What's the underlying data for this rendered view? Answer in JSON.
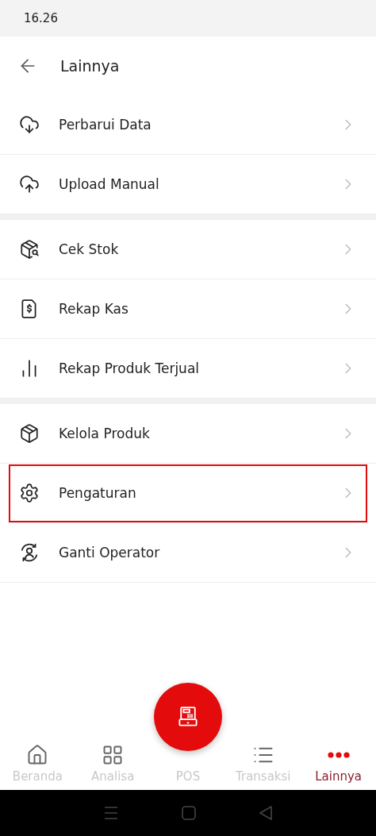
{
  "status_bar": {
    "time": "16.26"
  },
  "header": {
    "title": "Lainnya"
  },
  "groups": [
    {
      "items": [
        {
          "kind": "download",
          "label": "Perbarui Data",
          "highlighted": false
        },
        {
          "kind": "upload",
          "label": "Upload Manual",
          "highlighted": false
        }
      ]
    },
    {
      "items": [
        {
          "kind": "stock",
          "label": "Cek Stok",
          "highlighted": false
        },
        {
          "kind": "cash",
          "label": "Rekap Kas",
          "highlighted": false
        },
        {
          "kind": "sales",
          "label": "Rekap Produk Terjual",
          "highlighted": false
        }
      ]
    },
    {
      "items": [
        {
          "kind": "product",
          "label": "Kelola Produk",
          "highlighted": false
        },
        {
          "kind": "settings",
          "label": "Pengaturan",
          "highlighted": true
        },
        {
          "kind": "operator",
          "label": "Ganti Operator",
          "highlighted": false
        }
      ]
    }
  ],
  "bottom_nav": [
    {
      "kind": "home",
      "label": "Beranda",
      "selected": false
    },
    {
      "kind": "analytics",
      "label": "Analisa",
      "selected": false
    },
    {
      "kind": "pos",
      "label": "POS",
      "selected": false
    },
    {
      "kind": "transactions",
      "label": "Transaksi",
      "selected": false
    },
    {
      "kind": "more",
      "label": "Lainnya",
      "selected": true
    }
  ]
}
